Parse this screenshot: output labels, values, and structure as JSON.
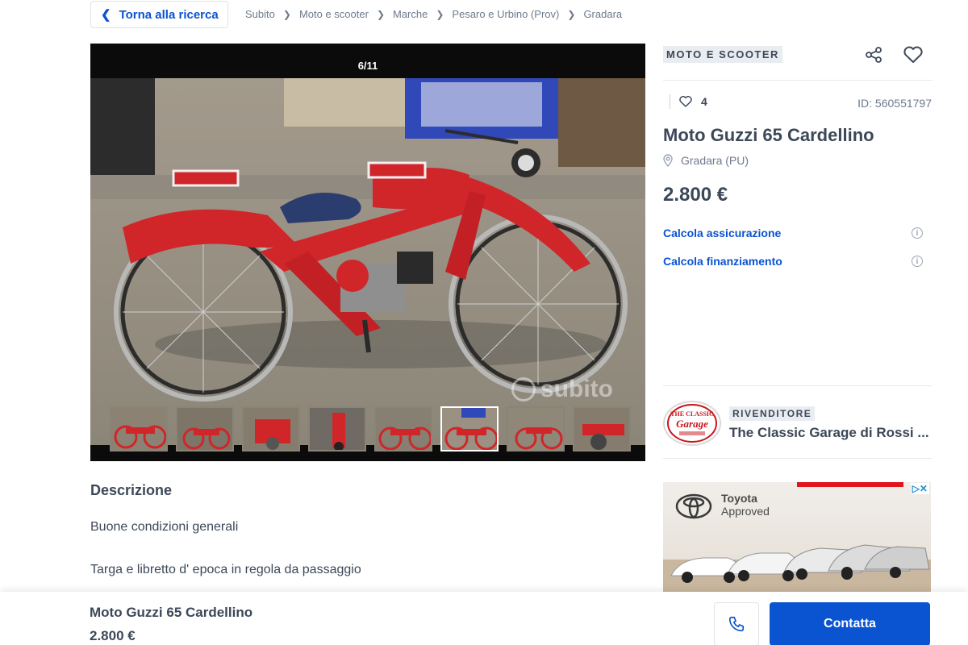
{
  "nav": {
    "back_label": "Torna alla ricerca",
    "breadcrumb": [
      "Subito",
      "Moto e scooter",
      "Marche",
      "Pesaro e Urbino (Prov)",
      "Gradara"
    ]
  },
  "gallery": {
    "counter": "6/11",
    "watermark": "subito",
    "thumbnail_count": 8,
    "active_thumbnail": 6
  },
  "listing": {
    "category": "MOTO E SCOOTER",
    "likes": "4",
    "ad_id": "ID: 560551797",
    "title": "Moto Guzzi 65 Cardellino",
    "location": "Gradara (PU)",
    "price": "2.800 €",
    "insurance_link": "Calcola assicurazione",
    "financing_link": "Calcola finanziamento"
  },
  "dealer": {
    "badge": "RIVENDITORE",
    "name": "The Classic Garage di Rossi ...",
    "logo_text": "THE CLASSIC Garage"
  },
  "ad": {
    "brand_line1": "Toyota",
    "brand_line2": "Approved"
  },
  "description": {
    "title": "Descrizione",
    "lines": [
      "Buone condizioni generali",
      "Targa e libretto d' epoca in regola da passaggio"
    ]
  },
  "footer": {
    "title": "Moto Guzzi 65 Cardellino",
    "price": "2.800 €",
    "contact_label": "Contatta"
  },
  "colors": {
    "accent_blue": "#0a53d1",
    "text_dark": "#3c4858",
    "text_muted": "#6d7b8c",
    "bike_red": "#d0262a"
  }
}
